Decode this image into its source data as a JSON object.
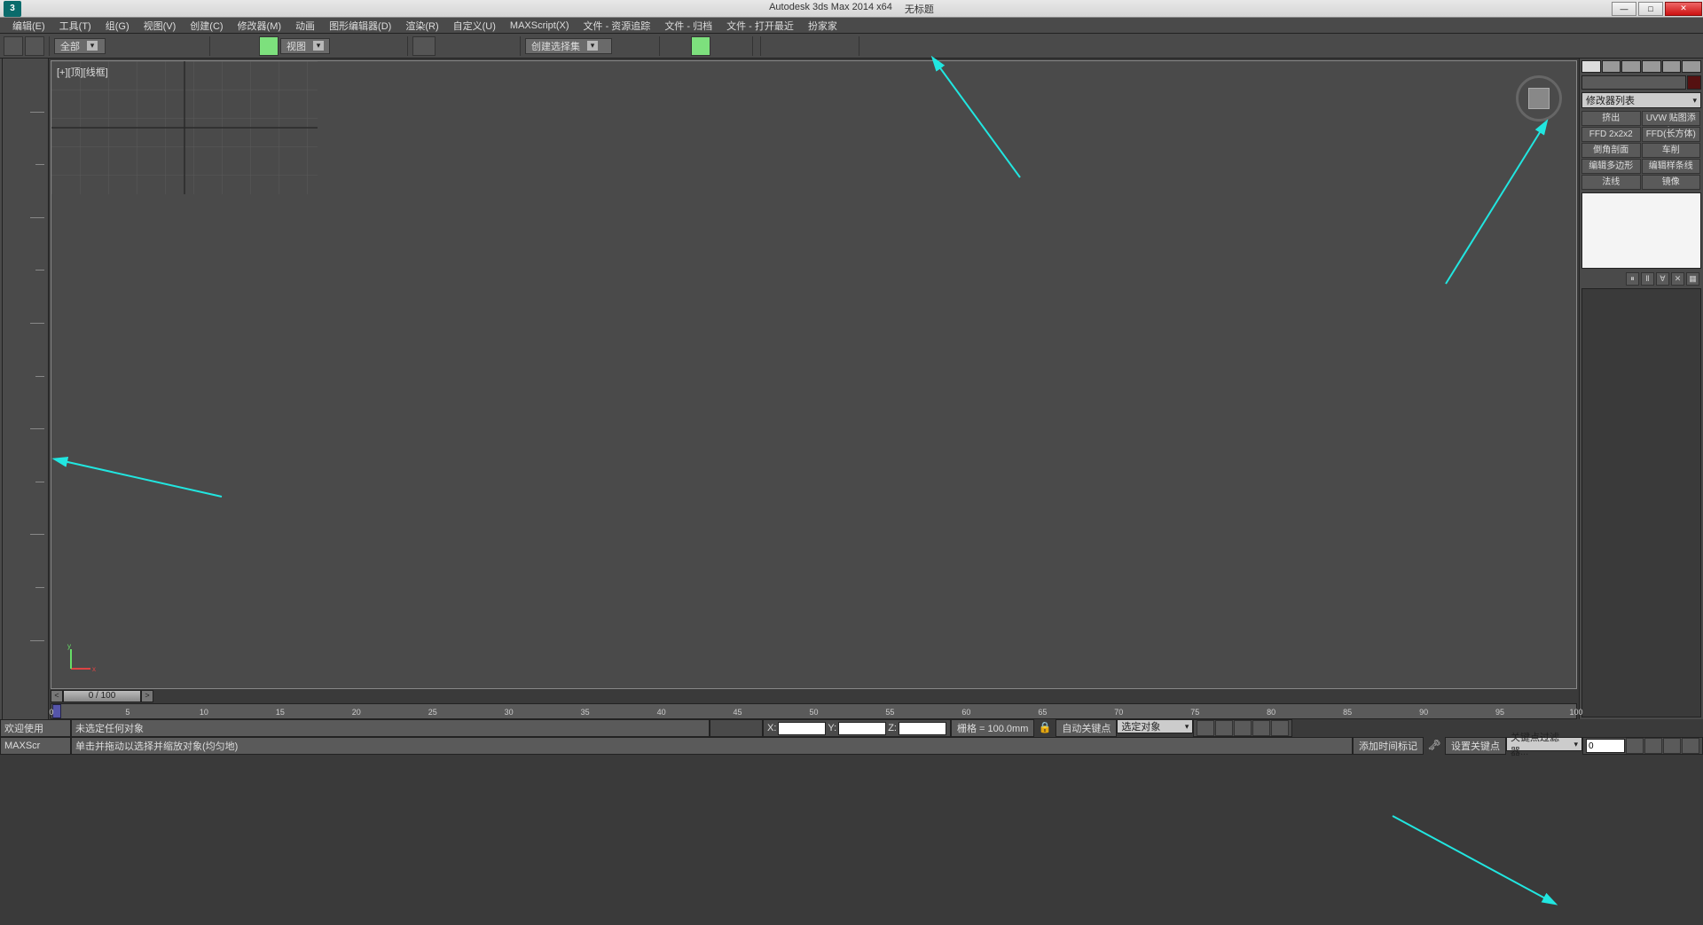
{
  "title": {
    "app": "Autodesk 3ds Max  2014 x64",
    "doc": "无标题",
    "file_hint": ""
  },
  "menu": [
    "编辑(E)",
    "工具(T)",
    "组(G)",
    "视图(V)",
    "创建(C)",
    "修改器(M)",
    "动画",
    "图形编辑器(D)",
    "渲染(R)",
    "自定义(U)",
    "MAXScript(X)",
    "文件 - 资源追踪",
    "文件 - 归档",
    "文件 - 打开最近",
    "扮家家"
  ],
  "toolbar": {
    "dd_all": "全部",
    "dd_view": "视图",
    "dd_selset": "创建选择集"
  },
  "viewport": {
    "label": "[+][顶][线框]"
  },
  "timeline": {
    "slider": "0 / 100",
    "ticks": [
      0,
      5,
      10,
      15,
      20,
      25,
      30,
      35,
      40,
      45,
      50,
      55,
      60,
      65,
      70,
      75,
      80,
      85,
      90,
      95,
      100
    ]
  },
  "panel": {
    "mod_list": "修改器列表",
    "mods": [
      "挤出",
      "UVW 贴图添加",
      "FFD 2x2x2",
      "FFD(长方体)",
      "倒角剖面",
      "车削",
      "编辑多边形",
      "编辑样条线",
      "法线",
      "镜像"
    ]
  },
  "status": {
    "welcome": "欢迎使用",
    "maxscript": "MAXScr",
    "no_selection": "未选定任何对象",
    "hint": "单击并拖动以选择并缩放对象(均匀地)",
    "x": "X:",
    "y": "Y:",
    "z": "Z:",
    "grid": "栅格 = 100.0mm",
    "autokey": "自动关键点",
    "selected": "选定对象",
    "setkey": "设置关键点",
    "keyfilter": "关键点过滤器...",
    "addtag": "添加时间标记",
    "frame": "0"
  }
}
